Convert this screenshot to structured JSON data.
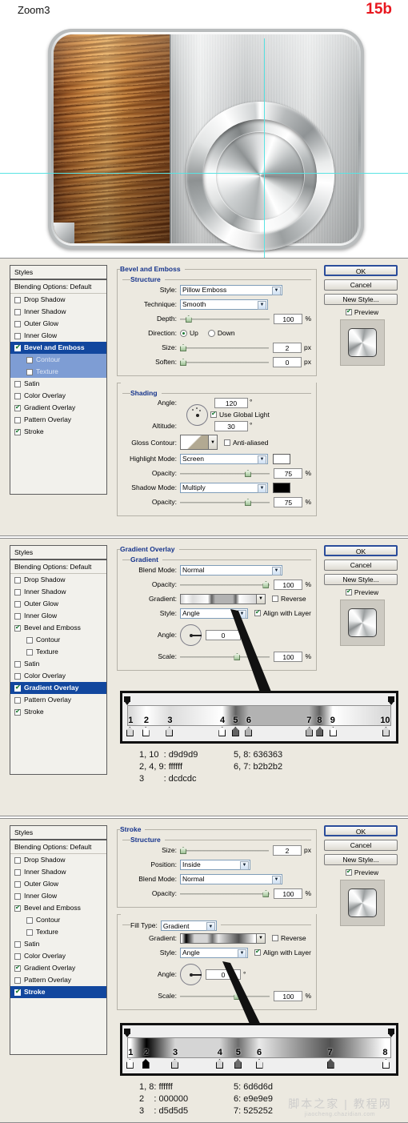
{
  "header": {
    "zoom_label": "Zoom3",
    "figure_label": "15b"
  },
  "product": {
    "name": "wood-and-metal-device-mockup",
    "wood_panel": "wood grain texture panel",
    "metal_panel": "brushed metal panel",
    "dial": "circular metallic dial"
  },
  "styles_list": {
    "header": "Styles",
    "blending_options": "Blending Options: Default",
    "items": [
      {
        "label": "Drop Shadow",
        "checked": false,
        "child": false
      },
      {
        "label": "Inner Shadow",
        "checked": false,
        "child": false
      },
      {
        "label": "Outer Glow",
        "checked": false,
        "child": false
      },
      {
        "label": "Inner Glow",
        "checked": false,
        "child": false
      },
      {
        "label": "Bevel and Emboss",
        "checked": true,
        "child": false
      },
      {
        "label": "Contour",
        "checked": false,
        "child": true
      },
      {
        "label": "Texture",
        "checked": false,
        "child": true
      },
      {
        "label": "Satin",
        "checked": false,
        "child": false
      },
      {
        "label": "Color Overlay",
        "checked": false,
        "child": false
      },
      {
        "label": "Gradient Overlay",
        "checked": true,
        "child": false
      },
      {
        "label": "Pattern Overlay",
        "checked": false,
        "child": false
      },
      {
        "label": "Stroke",
        "checked": true,
        "child": false
      }
    ]
  },
  "buttons": {
    "ok": "OK",
    "cancel": "Cancel",
    "new_style": "New Style...",
    "preview": "Preview"
  },
  "dialog1": {
    "selected_style": "Bevel and Emboss",
    "title": "Bevel and Emboss",
    "structure": {
      "legend": "Structure",
      "style_label": "Style:",
      "style_value": "Pillow Emboss",
      "technique_label": "Technique:",
      "technique_value": "Smooth",
      "depth_label": "Depth:",
      "depth_value": "100",
      "depth_unit": "%",
      "direction_label": "Direction:",
      "direction_up": "Up",
      "direction_down": "Down",
      "direction_selected": "Up",
      "size_label": "Size:",
      "size_value": "2",
      "size_unit": "px",
      "soften_label": "Soften:",
      "soften_value": "0",
      "soften_unit": "px"
    },
    "shading": {
      "legend": "Shading",
      "angle_label": "Angle:",
      "angle_value": "120",
      "angle_unit": "°",
      "use_global_light": "Use Global Light",
      "use_global_light_checked": true,
      "altitude_label": "Altitude:",
      "altitude_value": "30",
      "altitude_unit": "°",
      "gloss_contour_label": "Gloss Contour:",
      "anti_aliased": "Anti-aliased",
      "anti_aliased_checked": false,
      "highlight_mode_label": "Highlight Mode:",
      "highlight_mode_value": "Screen",
      "highlight_color": "#ffffff",
      "highlight_opacity_label": "Opacity:",
      "highlight_opacity_value": "75",
      "highlight_opacity_unit": "%",
      "shadow_mode_label": "Shadow Mode:",
      "shadow_mode_value": "Multiply",
      "shadow_color": "#000000",
      "shadow_opacity_label": "Opacity:",
      "shadow_opacity_value": "75",
      "shadow_opacity_unit": "%"
    }
  },
  "dialog2": {
    "selected_style": "Gradient Overlay",
    "title": "Gradient Overlay",
    "gradient": {
      "legend": "Gradient",
      "blend_mode_label": "Blend Mode:",
      "blend_mode_value": "Normal",
      "opacity_label": "Opacity:",
      "opacity_value": "100",
      "opacity_unit": "%",
      "gradient_label": "Gradient:",
      "reverse_label": "Reverse",
      "reverse_checked": false,
      "style_label": "Style:",
      "style_value": "Angle",
      "align_label": "Align with Layer",
      "align_checked": true,
      "angle_label": "Angle:",
      "angle_value": "0",
      "angle_unit": "°",
      "scale_label": "Scale:",
      "scale_value": "100",
      "scale_unit": "%"
    },
    "gradient_editor": {
      "stop_numbers": [
        "1",
        "2",
        "3",
        "4",
        "5",
        "6",
        "7",
        "8",
        "9",
        "10"
      ],
      "stop_positions": [
        1,
        7,
        16,
        36,
        41,
        46,
        69,
        73,
        78,
        98
      ],
      "stop_colors": [
        "#d9d9d9",
        "#ffffff",
        "#dcdcdc",
        "#ffffff",
        "#636363",
        "#b2b2b2",
        "#b2b2b2",
        "#636363",
        "#ffffff",
        "#d9d9d9"
      ],
      "legend_left": [
        "1, 10  : d9d9d9",
        "2, 4, 9: ffffff",
        "3        : dcdcdc"
      ],
      "legend_right": [
        "5, 8: 636363",
        "6, 7: b2b2b2",
        ""
      ]
    }
  },
  "dialog3": {
    "selected_style": "Stroke",
    "title": "Stroke",
    "structure": {
      "legend": "Structure",
      "size_label": "Size:",
      "size_value": "2",
      "size_unit": "px",
      "position_label": "Position:",
      "position_value": "Inside",
      "blend_mode_label": "Blend Mode:",
      "blend_mode_value": "Normal",
      "opacity_label": "Opacity:",
      "opacity_value": "100",
      "opacity_unit": "%"
    },
    "fill": {
      "fill_type_label": "Fill Type:",
      "fill_type_value": "Gradient",
      "gradient_label": "Gradient:",
      "reverse_label": "Reverse",
      "reverse_checked": false,
      "style_label": "Style:",
      "style_value": "Angle",
      "align_label": "Align with Layer",
      "align_checked": true,
      "angle_label": "Angle:",
      "angle_value": "0",
      "angle_unit": "°",
      "scale_label": "Scale:",
      "scale_value": "100",
      "scale_unit": "%"
    },
    "gradient_editor": {
      "stop_numbers": [
        "1",
        "2",
        "3",
        "4",
        "5",
        "6",
        "7",
        "8"
      ],
      "stop_positions": [
        1,
        7,
        18,
        35,
        42,
        50,
        77,
        98
      ],
      "stop_colors": [
        "#ffffff",
        "#000000",
        "#d5d5d5",
        "#d5d5d5",
        "#6d6d6d",
        "#e9e9e9",
        "#525252",
        "#ffffff"
      ],
      "legend_left": [
        "1, 8: ffffff",
        "2    : 000000",
        "3    : d5d5d5"
      ],
      "legend_right": [
        "5: 6d6d6d",
        "6: e9e9e9",
        "7: 525252"
      ]
    }
  },
  "watermark": {
    "main": "脚本之家 | 教程网",
    "sub": "jiaocheng.chazidian.com"
  }
}
